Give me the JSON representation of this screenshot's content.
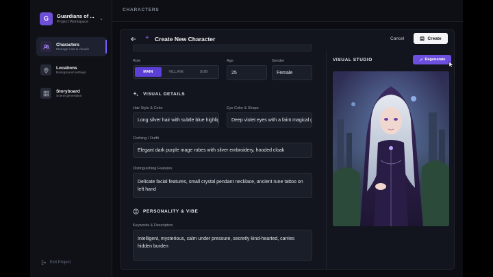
{
  "workspace": {
    "initial": "G",
    "title": "Guardians of ...",
    "subtitle": "Project Workspace"
  },
  "nav": [
    {
      "label": "Characters",
      "sub": "Manage cast & visuals",
      "icon": "users-icon",
      "active": true
    },
    {
      "label": "Locations",
      "sub": "Background settings",
      "icon": "map-pin-icon",
      "active": false
    },
    {
      "label": "Storyboard",
      "sub": "Scene generation",
      "icon": "grid-icon",
      "active": false
    }
  ],
  "exit_label": "Exit Project",
  "topbar": {
    "title": "CHARACTERS"
  },
  "panel": {
    "title": "Create New Character",
    "cancel": "Cancel",
    "create": "Create"
  },
  "form": {
    "role_label": "Role",
    "role_options": [
      "MAIN",
      "VILLAIN",
      "SUB"
    ],
    "role_selected": "MAIN",
    "age_label": "Age",
    "age_value": "25",
    "gender_label": "Gender",
    "gender_value": "Female",
    "visual_section": "VISUAL DETAILS",
    "hair_label": "Hair Style & Color",
    "hair_value": "Long silver hair with subtle blue highlights",
    "eye_label": "Eye Color & Shape",
    "eye_value": "Deep violet eyes with a faint magical glow",
    "clothing_label": "Clothing / Outfit",
    "clothing_value": "Elegant dark purple mage robes with silver embroidery, hooded cloak",
    "features_label": "Distinguishing Features",
    "features_value": "Delicate facial features, small crystal pendant necklace, ancient rune tattoo on left hand",
    "personality_section": "PERSONALITY & VIBE",
    "keywords_label": "Keywords & Description",
    "keywords_value": "Intelligent, mysterious, calm under pressure, secretly kind-hearted, carries hidden burden"
  },
  "visual_studio": {
    "title": "VISUAL STUDIO",
    "regenerate": "Regenerate"
  },
  "colors": {
    "accent": "#6d4fe0",
    "background": "#0b0d12",
    "panel": "#12151d"
  }
}
